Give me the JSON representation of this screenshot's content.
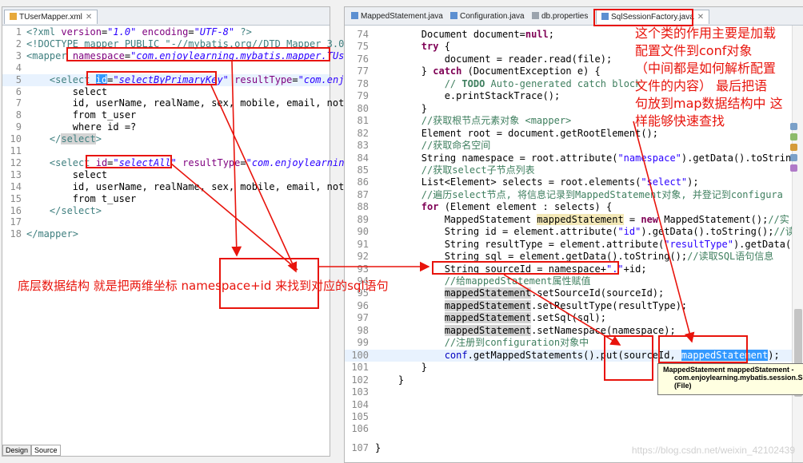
{
  "left_editor": {
    "tab_label": "TUserMapper.xml",
    "bottom_tabs": [
      "Design",
      "Source"
    ]
  },
  "right_editor": {
    "tabs": [
      "MappedStatement.java",
      "Configuration.java",
      "db.properties",
      "SqlSessionFactory.java"
    ]
  },
  "annotations": {
    "top_right_note": [
      "这个类的作用主要是加载",
      "配置文件到conf对象",
      "（中间都是如何解析配置",
      "文件的内容） 最后把语",
      "句放到map数据结构中 这",
      "样能够快速查找"
    ],
    "bottom_note": "底层数据结构 就是把两维坐标 namespace+id 来找到对应的sql语句"
  },
  "tooltip": {
    "line1": "MappedStatement mappedStatement -",
    "line2": "com.enjoylearning.mybatis.session.Sql",
    "line3": "(File)"
  },
  "watermark": "https://blog.csdn.net/weixin_42102439",
  "colors": {
    "annotation_red": "#e8140c",
    "selection_blue": "#3399ff"
  }
}
